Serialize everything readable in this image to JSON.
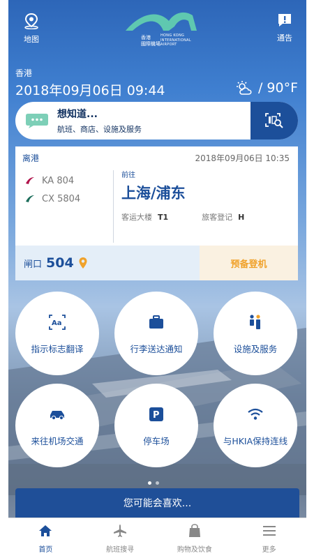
{
  "topbar": {
    "map_label": "地图",
    "message_label": "通告",
    "logo": {
      "cn_line1": "香港",
      "cn_line2": "國際機場",
      "en_line1": "HONG KONG",
      "en_line2": "INTERNATIONAL",
      "en_line3": "AIRPORT"
    }
  },
  "location": "香港",
  "datetime": "2018年09月06日 09:44",
  "weather": {
    "icon": "partly-cloudy-icon",
    "temp": "/ 90°F"
  },
  "search": {
    "title": "想知道...",
    "subtitle": "航班、商店、设施及服务"
  },
  "flight": {
    "type": "离港",
    "datetime": "2018年09月06日 10:35",
    "codes": [
      "KA 804",
      "CX 5804"
    ],
    "to_label": "前往",
    "destination": "上海/浦东",
    "terminal_label": "客运大楼",
    "terminal": "T1",
    "checkin_label": "旅客登记",
    "checkin": "H",
    "gate_label": "闸口",
    "gate": "504",
    "board_label": "预备登机"
  },
  "services": [
    {
      "label": "指示标志翻译",
      "icon": "translate-icon"
    },
    {
      "label": "行李送达通知",
      "icon": "baggage-icon"
    },
    {
      "label": "设施及服务",
      "icon": "facilities-icon"
    },
    {
      "label": "来往机场交通",
      "icon": "car-icon"
    },
    {
      "label": "停车场",
      "icon": "parking-icon"
    },
    {
      "label": "与HKIA保持连线",
      "icon": "wifi-icon"
    }
  ],
  "pager": {
    "pages": 2,
    "current": 1
  },
  "banner": "您可能会喜欢...",
  "tabs": [
    {
      "label": "首页",
      "icon": "home-icon",
      "active": true
    },
    {
      "label": "航班搜寻",
      "icon": "plane-icon",
      "active": false
    },
    {
      "label": "购物及饮食",
      "icon": "shopping-bag-icon",
      "active": false
    },
    {
      "label": "更多",
      "icon": "menu-icon",
      "active": false
    }
  ],
  "colors": {
    "primary": "#1c4f9a",
    "accent": "#f0a22b",
    "logo_green": "#5fc8b0"
  }
}
